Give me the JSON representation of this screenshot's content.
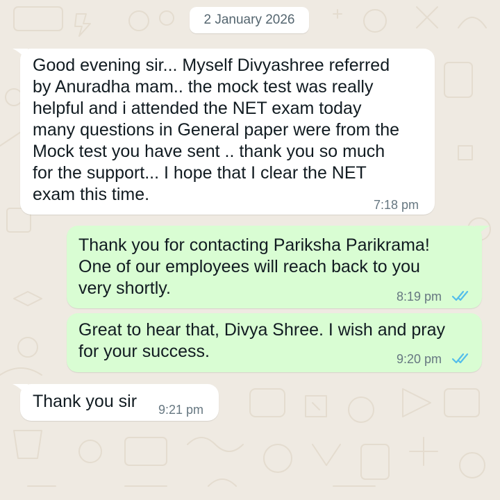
{
  "chat": {
    "date_chip": "2 January 2026",
    "messages": [
      {
        "direction": "incoming",
        "lines": [
          "Good evening sir... Myself Divyashree referred",
          "by Anuradha mam.. the mock test was really",
          "helpful and i attended the NET exam today",
          "many questions in General paper were from the",
          "Mock test you have sent .. thank you so much",
          "for the support... I hope that I clear the NET",
          "exam this time."
        ],
        "time": "7:18 pm"
      },
      {
        "direction": "outgoing",
        "lines": [
          "Thank you for contacting Pariksha Parikrama!",
          "One of our employees will reach back to you",
          "very shortly."
        ],
        "time": "8:19 pm",
        "status": "read"
      },
      {
        "direction": "outgoing",
        "lines": [
          "Great to hear that, Divya Shree. I wish and pray",
          "for your success."
        ],
        "time": "9:20 pm",
        "status": "read"
      },
      {
        "direction": "incoming",
        "lines": [
          "Thank you sir"
        ],
        "time": "9:21 pm"
      }
    ]
  },
  "theme": {
    "wallpaper_bg": "#efeae2",
    "wallpaper_doodle": "#e4dccf",
    "incoming_bubble": "#ffffff",
    "outgoing_bubble": "#d9fdd3",
    "text_color": "#111b21",
    "time_color": "#667781",
    "read_tick_color": "#53bdeb"
  }
}
